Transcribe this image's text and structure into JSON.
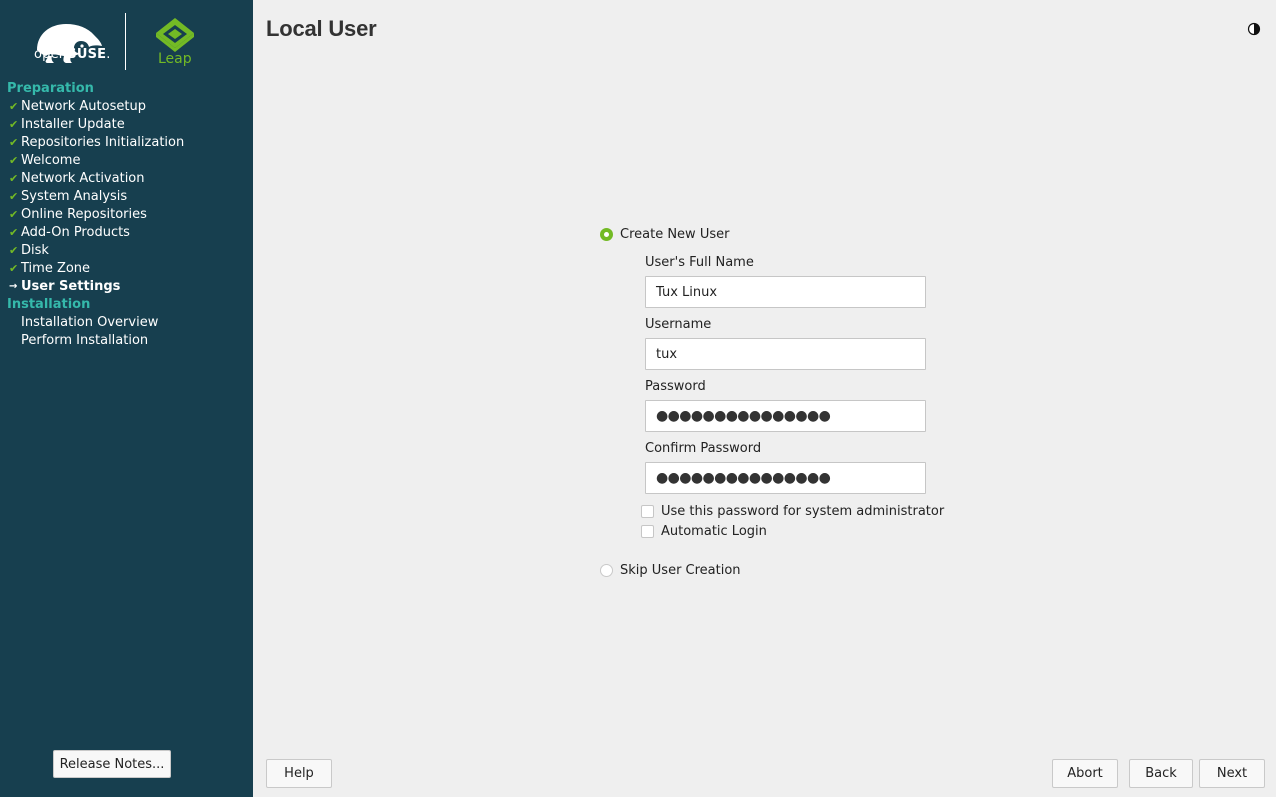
{
  "branding": {
    "distro": "openSUSE",
    "distro_light": "open",
    "distro_bold": "SUSE",
    "edition": "Leap"
  },
  "sidebar": {
    "sections": [
      {
        "heading": "Preparation",
        "items": [
          {
            "label": "Network Autosetup",
            "state": "done"
          },
          {
            "label": "Installer Update",
            "state": "done"
          },
          {
            "label": "Repositories Initialization",
            "state": "done"
          },
          {
            "label": "Welcome",
            "state": "done"
          },
          {
            "label": "Network Activation",
            "state": "done"
          },
          {
            "label": "System Analysis",
            "state": "done"
          },
          {
            "label": "Online Repositories",
            "state": "done"
          },
          {
            "label": "Add-On Products",
            "state": "done"
          },
          {
            "label": "Disk",
            "state": "done"
          },
          {
            "label": "Time Zone",
            "state": "done"
          },
          {
            "label": "User Settings",
            "state": "current"
          }
        ]
      },
      {
        "heading": "Installation",
        "items": [
          {
            "label": "Installation Overview",
            "state": "pending"
          },
          {
            "label": "Perform Installation",
            "state": "pending"
          }
        ]
      }
    ],
    "release_notes_label": "Release Notes...",
    "check_icon": "✔",
    "arrow_icon": "→"
  },
  "page": {
    "title": "Local User"
  },
  "form": {
    "create_option": "Create New User",
    "full_name": {
      "label": "User's Full Name",
      "value": "Tux Linux"
    },
    "username": {
      "label": "Username",
      "value": "tux"
    },
    "password": {
      "label": "Password",
      "value": "●●●●●●●●●●●●●●●"
    },
    "confirm_password": {
      "label": "Confirm Password",
      "value": "●●●●●●●●●●●●●●●"
    },
    "use_for_admin_label": "Use this password for system administrator",
    "use_for_admin_checked": false,
    "auto_login_label": "Automatic Login",
    "auto_login_checked": false,
    "skip_option": "Skip User Creation",
    "selected_option": "create"
  },
  "buttons": {
    "help": "Help",
    "abort": "Abort",
    "back": "Back",
    "next": "Next"
  },
  "colors": {
    "sidebar_bg": "#173f4f",
    "accent_green": "#73ba25",
    "heading_teal": "#35b9ab",
    "content_bg": "#efefef"
  }
}
